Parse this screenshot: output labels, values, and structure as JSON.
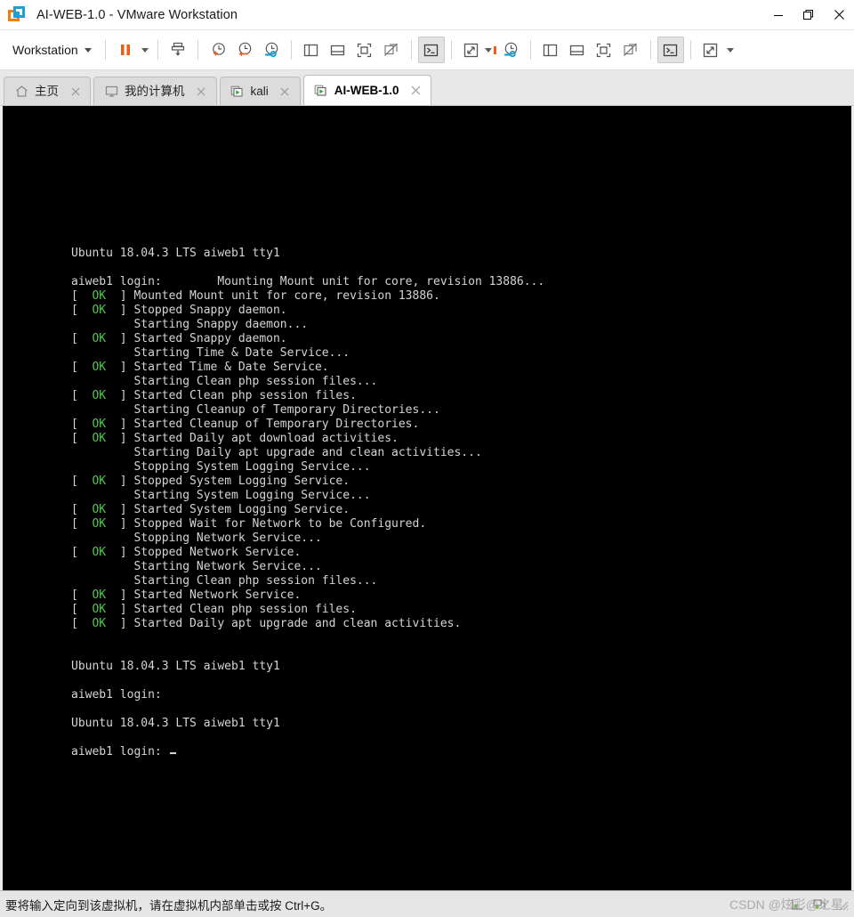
{
  "window": {
    "title": "AI-WEB-1.0 - VMware Workstation",
    "app_icon": "vmware-logo-icon",
    "controls": {
      "minimize": "minimize-icon",
      "restore": "restore-icon",
      "close": "close-icon"
    }
  },
  "toolbar": {
    "menu_label": "Workstation",
    "buttons": [
      {
        "name": "pause-vm-button",
        "icon": "pause-icon"
      },
      {
        "name": "pause-dropdown",
        "icon": "chevron-down-icon"
      },
      {
        "name": "suspend-vm-button",
        "icon": "suspend-guest-icon"
      },
      {
        "name": "take-snapshot-button",
        "icon": "snapshot-add-icon"
      },
      {
        "name": "revert-snapshot-button",
        "icon": "snapshot-revert-icon"
      },
      {
        "name": "manage-snapshots-button",
        "icon": "snapshot-manager-icon"
      },
      {
        "name": "show-library-button",
        "icon": "library-panel-icon"
      },
      {
        "name": "show-thumbnail-bar-button",
        "icon": "thumbnail-bar-icon"
      },
      {
        "name": "enter-fullscreen-button",
        "icon": "fullscreen-icon"
      },
      {
        "name": "unity-mode-button",
        "icon": "unity-disabled-icon"
      },
      {
        "name": "console-view-button",
        "icon": "console-icon"
      },
      {
        "name": "stretch-guest-button",
        "icon": "stretch-icon"
      },
      {
        "name": "stretch-dropdown",
        "icon": "chevron-down-icon"
      },
      {
        "name": "manage-snapshots-button-2",
        "icon": "snapshot-manager-icon"
      },
      {
        "name": "show-library-button-2",
        "icon": "library-panel-icon"
      },
      {
        "name": "show-thumbnail-bar-button-2",
        "icon": "thumbnail-bar-icon"
      },
      {
        "name": "enter-fullscreen-button-2",
        "icon": "fullscreen-icon"
      },
      {
        "name": "unity-mode-button-2",
        "icon": "unity-disabled-icon"
      },
      {
        "name": "console-view-button-2",
        "icon": "console-icon"
      },
      {
        "name": "stretch-guest-button-2",
        "icon": "stretch-icon"
      }
    ]
  },
  "tabs": [
    {
      "label": "主页",
      "icon": "home-icon",
      "active": false
    },
    {
      "label": "我的计算机",
      "icon": "monitor-icon",
      "active": false
    },
    {
      "label": "kali",
      "icon": "vm-play-icon",
      "active": false
    },
    {
      "label": "AI-WEB-1.0",
      "icon": "vm-play-icon",
      "active": true
    }
  ],
  "guest_console": {
    "lines": [
      {
        "type": "text",
        "text": "Ubuntu 18.04.3 LTS aiweb1 tty1"
      },
      {
        "type": "blank"
      },
      {
        "type": "text",
        "text": "aiweb1 login:        Mounting Mount unit for core, revision 13886..."
      },
      {
        "type": "ok",
        "text": "Mounted Mount unit for core, revision 13886."
      },
      {
        "type": "ok",
        "text": "Stopped Snappy daemon."
      },
      {
        "type": "indent",
        "text": "Starting Snappy daemon..."
      },
      {
        "type": "ok",
        "text": "Started Snappy daemon."
      },
      {
        "type": "indent",
        "text": "Starting Time & Date Service..."
      },
      {
        "type": "ok",
        "text": "Started Time & Date Service."
      },
      {
        "type": "indent",
        "text": "Starting Clean php session files..."
      },
      {
        "type": "ok",
        "text": "Started Clean php session files."
      },
      {
        "type": "indent",
        "text": "Starting Cleanup of Temporary Directories..."
      },
      {
        "type": "ok",
        "text": "Started Cleanup of Temporary Directories."
      },
      {
        "type": "ok",
        "text": "Started Daily apt download activities."
      },
      {
        "type": "indent",
        "text": "Starting Daily apt upgrade and clean activities..."
      },
      {
        "type": "indent",
        "text": "Stopping System Logging Service..."
      },
      {
        "type": "ok",
        "text": "Stopped System Logging Service."
      },
      {
        "type": "indent",
        "text": "Starting System Logging Service..."
      },
      {
        "type": "ok",
        "text": "Started System Logging Service."
      },
      {
        "type": "ok",
        "text": "Stopped Wait for Network to be Configured."
      },
      {
        "type": "indent",
        "text": "Stopping Network Service..."
      },
      {
        "type": "ok",
        "text": "Stopped Network Service."
      },
      {
        "type": "indent",
        "text": "Starting Network Service..."
      },
      {
        "type": "indent",
        "text": "Starting Clean php session files..."
      },
      {
        "type": "ok",
        "text": "Started Network Service."
      },
      {
        "type": "ok",
        "text": "Started Clean php session files."
      },
      {
        "type": "ok",
        "text": "Started Daily apt upgrade and clean activities."
      },
      {
        "type": "blank"
      },
      {
        "type": "blank"
      },
      {
        "type": "text",
        "text": "Ubuntu 18.04.3 LTS aiweb1 tty1"
      },
      {
        "type": "blank"
      },
      {
        "type": "text",
        "text": "aiweb1 login:"
      },
      {
        "type": "blank"
      },
      {
        "type": "text",
        "text": "Ubuntu 18.04.3 LTS aiweb1 tty1"
      },
      {
        "type": "blank"
      },
      {
        "type": "prompt",
        "text": "aiweb1 login: "
      }
    ],
    "ok_tag": "OK",
    "colors": {
      "background": "#000000",
      "foreground": "#d4d4d4",
      "ok_green": "#4ec94e"
    }
  },
  "statusbar": {
    "message": "要将输入定向到该虚拟机，请在虚拟机内部单击或按 Ctrl+G。",
    "indicators": [
      {
        "name": "hard-disk-indicator-icon"
      },
      {
        "name": "network-adapter-indicator-icon"
      }
    ]
  },
  "watermark": {
    "text": "CSDN @炫彩@之星"
  }
}
